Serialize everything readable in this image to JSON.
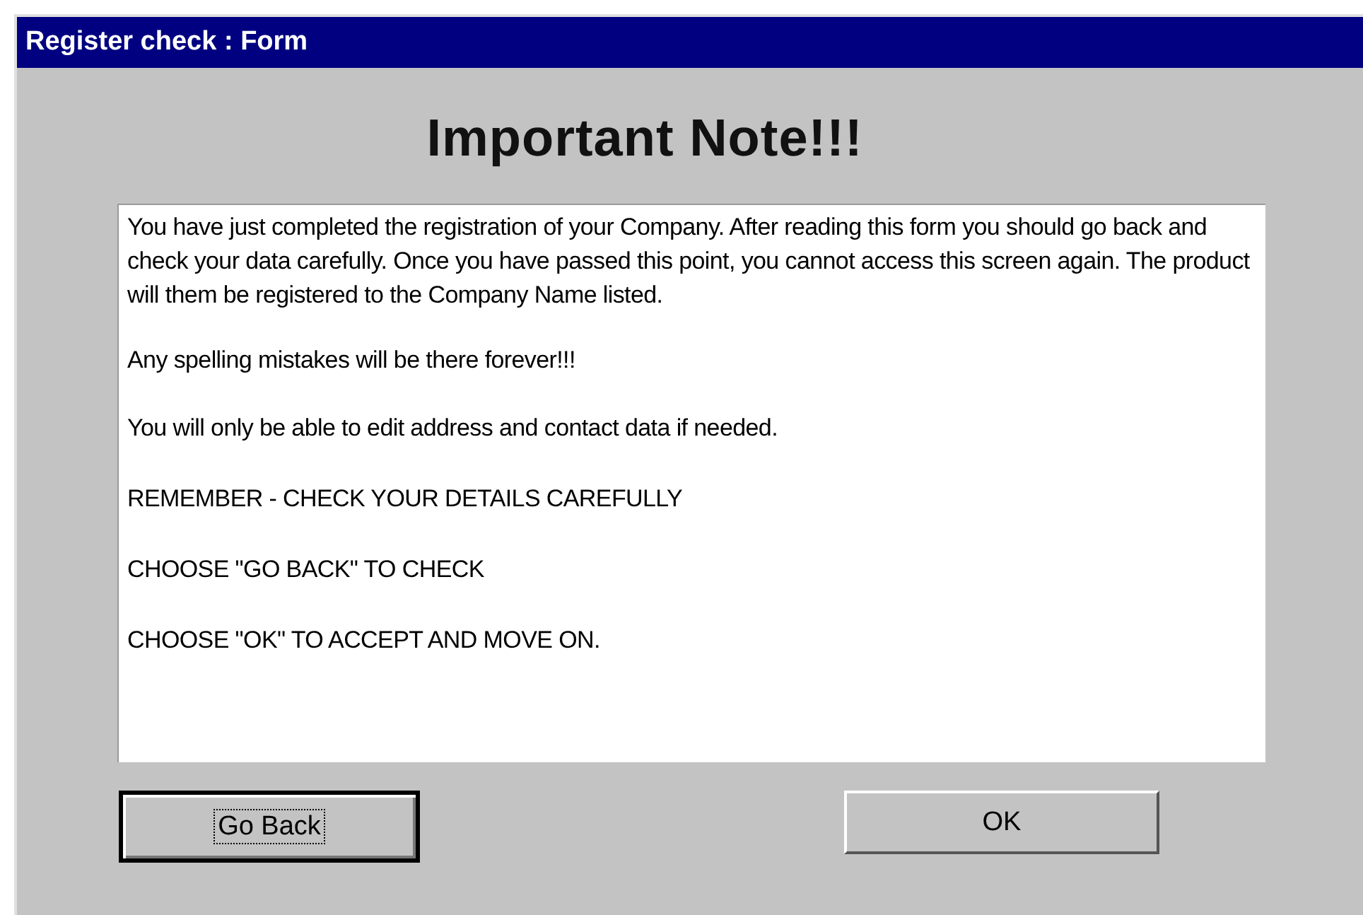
{
  "window": {
    "title": "Register check : Form"
  },
  "heading": "Important Note!!!",
  "message": [
    "You have just completed the registration of your Company. After reading this form you should go back and check your data carefully. Once you have passed this point, you cannot access this screen again. The product will them be registered to the Company Name listed.",
    "Any spelling mistakes will be there forever!!!",
    "You will only be able to edit address and contact data if needed.",
    "REMEMBER - CHECK YOUR DETAILS CAREFULLY",
    "CHOOSE \"GO BACK\" TO CHECK",
    "CHOOSE \"OK\" TO ACCEPT AND MOVE ON."
  ],
  "buttons": [
    {
      "label": "Go Back",
      "focused": true
    },
    {
      "label": "OK",
      "focused": false
    }
  ]
}
